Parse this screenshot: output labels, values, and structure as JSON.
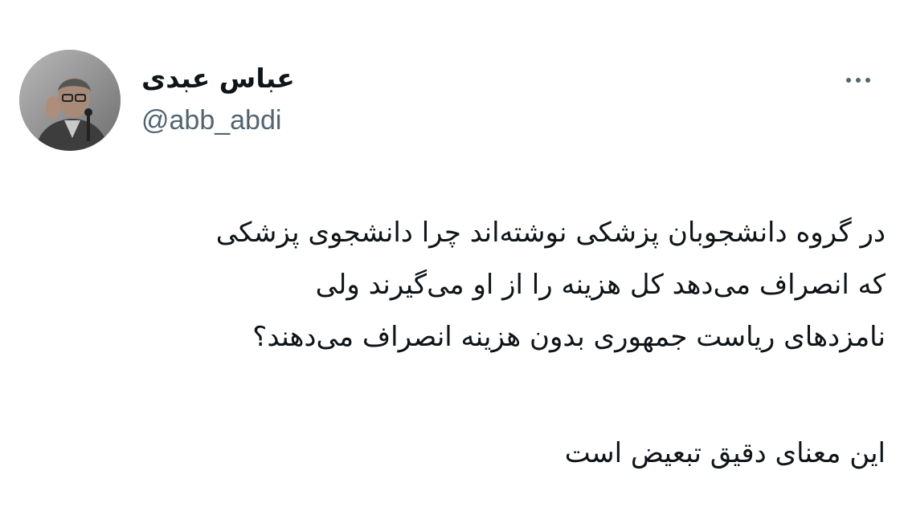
{
  "tweet": {
    "author": {
      "display_name": "عباس عبدی",
      "handle": "@abb_abdi",
      "avatar_icon": "profile-photo"
    },
    "more_icon": "more-horizontal-icon",
    "text_paragraph_1": [
      "در گروه دانشجوبان پزشکی نوشته‌اند چرا دانشجوی پزشکی",
      "که انصراف می‌دهد کل هزینه را از او می‌گیرند ولی",
      "نامزدهای ریاست جمهوری بدون هزینه انصراف می‌دهند؟"
    ],
    "text_paragraph_2": [
      "این معنای دقیق تبعیض است"
    ]
  },
  "colors": {
    "background": "#ffffff",
    "text_primary": "#0f1419",
    "text_secondary": "#536471"
  }
}
